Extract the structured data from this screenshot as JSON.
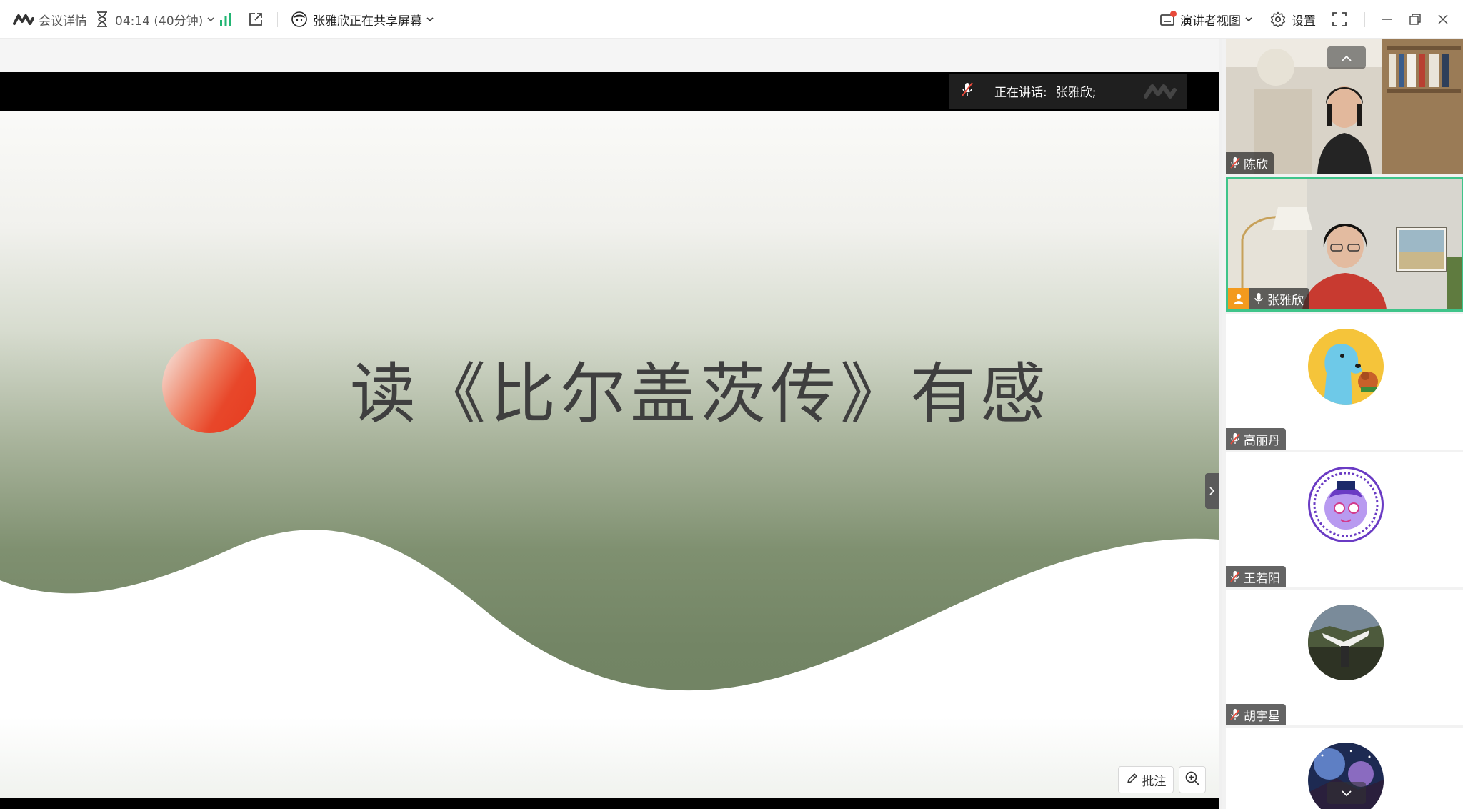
{
  "toolbar": {
    "meeting_details": "会议详情",
    "timer": "04:14 (40分钟)",
    "sharing_status": "张雅欣正在共享屏幕",
    "presenter_view": "演讲者视图",
    "settings": "设置"
  },
  "speaking": {
    "label": "正在讲话:",
    "speaker": "张雅欣;"
  },
  "slide": {
    "title": "读《比尔盖茨传》有感"
  },
  "tools": {
    "annotate": "批注"
  },
  "participants": [
    {
      "name": "陈欣",
      "muted": true
    },
    {
      "name": "张雅欣",
      "muted": false,
      "active_speaker": true
    },
    {
      "name": "高丽丹",
      "muted": true
    },
    {
      "name": "王若阳",
      "muted": true
    },
    {
      "name": "胡宇星",
      "muted": true
    }
  ],
  "colors": {
    "active_border": "#3fc48a",
    "signal_green": "#22b573",
    "muted_red": "#e84a3b",
    "host_orange": "#f39a1e",
    "sun_red": "#e8472a"
  },
  "icons": [
    "tencent-meeting-logo-icon",
    "hourglass-icon",
    "chevron-down-icon",
    "signal-bars-icon",
    "share-external-icon",
    "avatar-icon",
    "presenter-view-icon",
    "gear-icon",
    "fullscreen-icon",
    "minimize-icon",
    "restore-icon",
    "close-icon",
    "mic-muted-icon",
    "mic-icon",
    "host-icon",
    "pen-icon",
    "zoom-in-icon",
    "chevron-up-icon",
    "chevron-right-icon"
  ]
}
